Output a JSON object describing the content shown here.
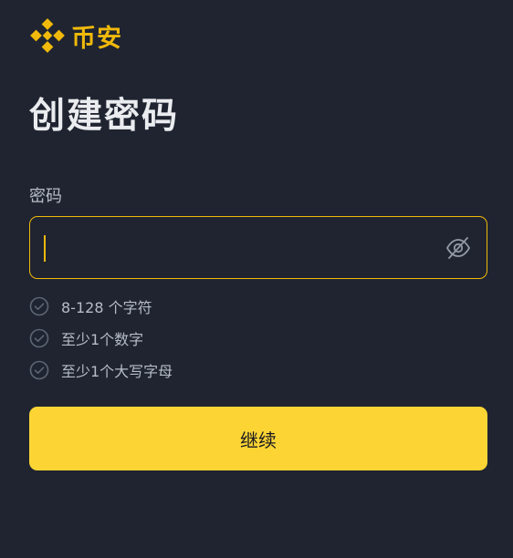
{
  "brand": {
    "name": "币安",
    "logo_icon": "binance-logo-icon",
    "color": "#f0b90b"
  },
  "page": {
    "title": "创建密码"
  },
  "password": {
    "label": "密码",
    "value": "",
    "toggle_icon": "eye-off-icon"
  },
  "requirements": [
    {
      "text": "8-128 个字符",
      "icon": "check-circle-icon"
    },
    {
      "text": "至少1个数字",
      "icon": "check-circle-icon"
    },
    {
      "text": "至少1个大写字母",
      "icon": "check-circle-icon"
    }
  ],
  "actions": {
    "continue_label": "继续",
    "continue_color": "#fcd535"
  },
  "colors": {
    "background": "#1f2430",
    "accent": "#f0b90b",
    "text_primary": "#eaecef",
    "text_secondary": "#b7bdc6"
  }
}
